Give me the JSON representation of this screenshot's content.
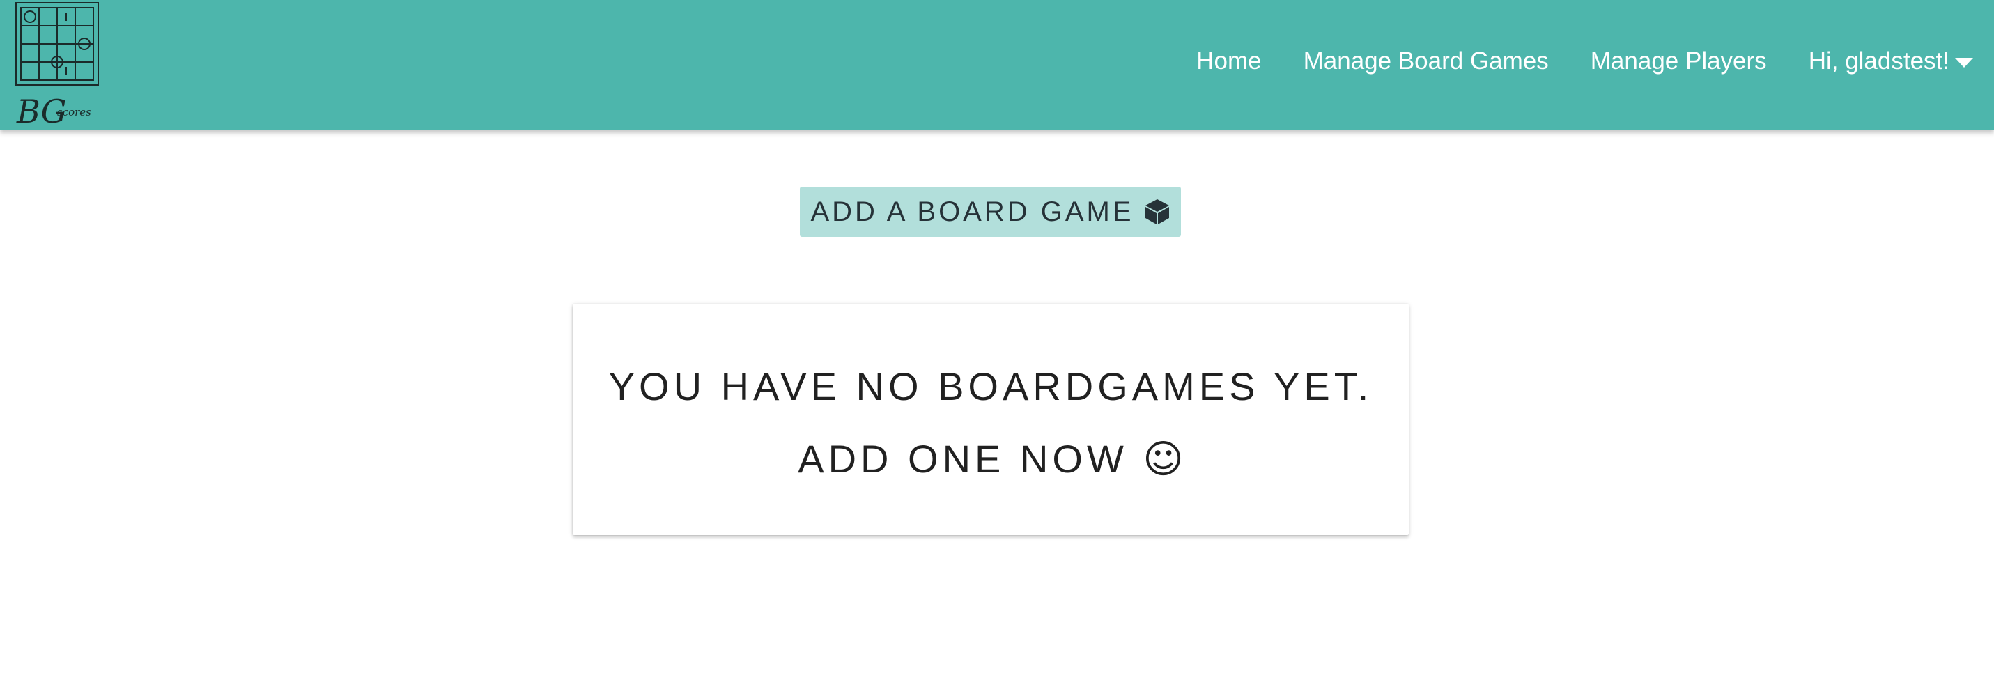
{
  "header": {
    "logo": {
      "name": "BG scores",
      "text_initials": "BG",
      "text_sub": "scores"
    },
    "nav": [
      {
        "label": "Home"
      },
      {
        "label": "Manage Board Games"
      },
      {
        "label": "Manage Players"
      },
      {
        "label": "Hi, gladstest!",
        "icon": "caret-down-icon"
      }
    ]
  },
  "main": {
    "add_button": {
      "label": "ADD A BOARD GAME",
      "icon": "cube-icon"
    },
    "empty_card": {
      "line1": "YOU HAVE NO BOARDGAMES YET.",
      "line2": "ADD ONE NOW",
      "emoji": "☺"
    }
  },
  "colors": {
    "navbar": "#4db6ac",
    "button": "#b2dfdb",
    "text_dark": "#212121",
    "nav_text": "#ffffff"
  }
}
